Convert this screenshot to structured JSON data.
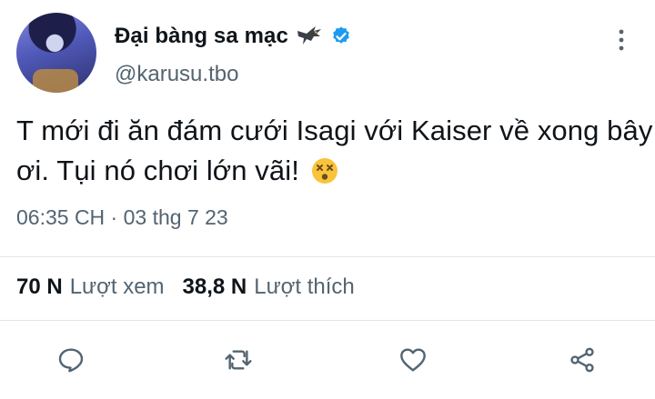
{
  "tweet": {
    "display_name": "Đại bàng sa mạc",
    "handle": "@karusu.tbo",
    "text": "T mới đi ăn đám cưới Isagi với Kaiser về xong bây ơi. Tụi nó chơi lớn vãi!",
    "emoji": "dizzy-face-emoji",
    "timestamp": "06:35 CH · 03 thg 7 23"
  },
  "stats": {
    "views_count": "70 N",
    "views_label": "Lượt xem",
    "likes_count": "38,8 N",
    "likes_label": "Lượt thích"
  },
  "icons": {
    "verified": "verified-badge-icon",
    "eagle": "eagle-icon",
    "more": "more-vertical-icon",
    "reply": "reply-icon",
    "retweet": "retweet-icon",
    "like": "heart-icon",
    "share": "share-icon"
  },
  "colors": {
    "verified_blue": "#1d9bf0",
    "secondary_text": "#536471",
    "primary_text": "#0f1419"
  }
}
